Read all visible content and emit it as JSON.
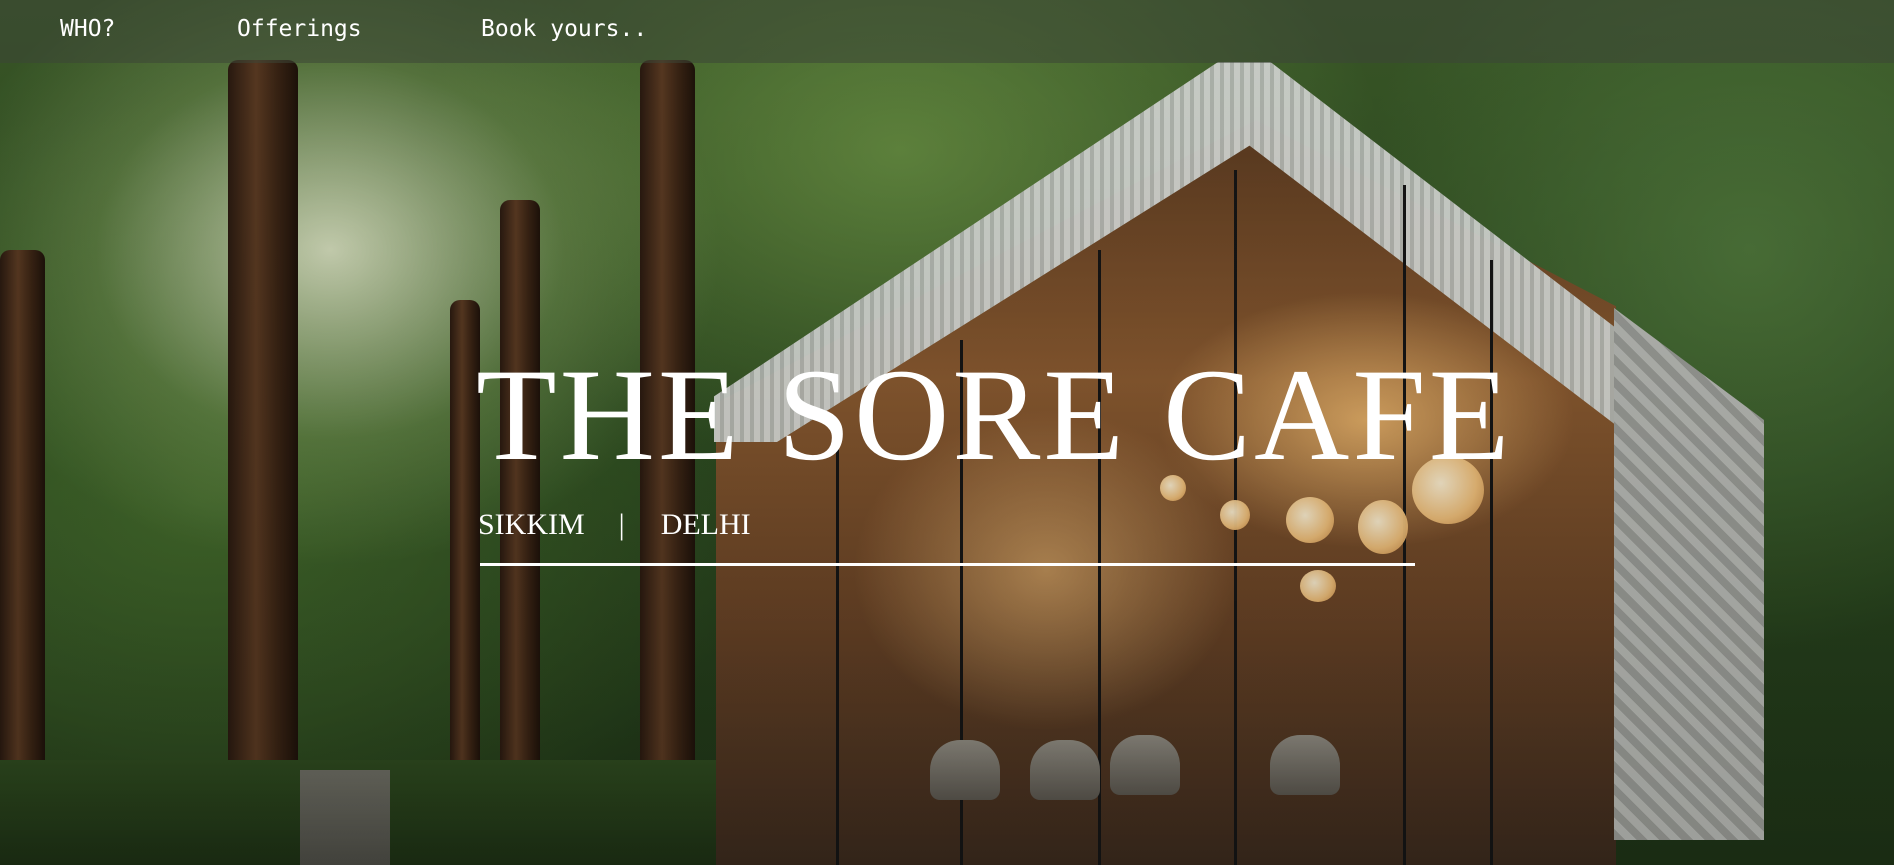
{
  "nav": {
    "items": [
      {
        "label": "WHO?"
      },
      {
        "label": "Offerings"
      },
      {
        "label": "Book yours.."
      }
    ]
  },
  "hero": {
    "title": "THE SORE CAFE",
    "locations": [
      "SIKKIM",
      "DELHI"
    ],
    "separator": "|"
  },
  "colors": {
    "text": "#ffffff",
    "nav_bar": "rgba(60,70,55,0.55)"
  }
}
